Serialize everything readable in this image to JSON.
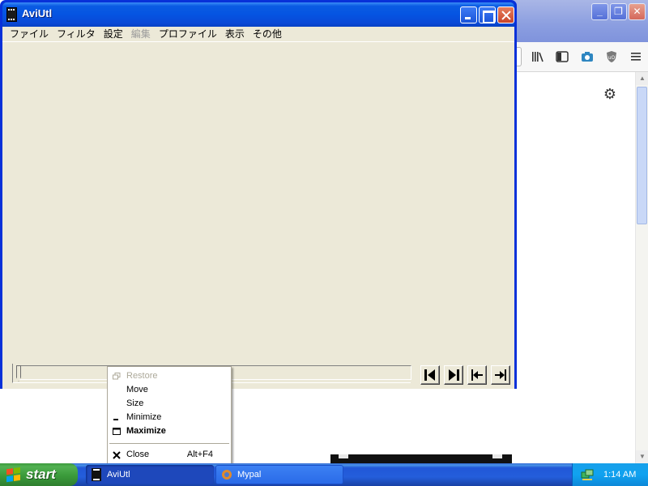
{
  "aviutl": {
    "title": "AviUtl",
    "menu": [
      {
        "label": "ファイル",
        "enabled": true
      },
      {
        "label": "フィルタ",
        "enabled": true
      },
      {
        "label": "設定",
        "enabled": true
      },
      {
        "label": "編集",
        "enabled": false
      },
      {
        "label": "プロファイル",
        "enabled": true
      },
      {
        "label": "表示",
        "enabled": true
      },
      {
        "label": "その他",
        "enabled": true
      }
    ],
    "nav_buttons": [
      "prev-frame-icon",
      "next-frame-icon",
      "first-frame-icon",
      "last-frame-icon"
    ],
    "colors": {
      "titlebar": "#0554e2",
      "client": "#ece9d8"
    }
  },
  "context_menu": {
    "items": [
      {
        "label": "Restore",
        "icon": "restore-icon",
        "enabled": false
      },
      {
        "label": "Move",
        "icon": "",
        "enabled": true
      },
      {
        "label": "Size",
        "icon": "",
        "enabled": true
      },
      {
        "label": "Minimize",
        "icon": "minimize-icon",
        "enabled": true
      },
      {
        "label": "Maximize",
        "icon": "maximize-icon",
        "enabled": true,
        "bold": true
      },
      {
        "label": "Close",
        "icon": "close-icon",
        "enabled": true,
        "shortcut": "Alt+F4"
      }
    ]
  },
  "browser_toolbar": {
    "icons": [
      "library-icon",
      "sidebar-icon",
      "screenshot-icon",
      "ublock-icon",
      "hamburger-menu-icon",
      "settings-gear-icon"
    ]
  },
  "taskbar": {
    "start_label": "start",
    "tasks": [
      {
        "label": "AviUtl",
        "active": true
      },
      {
        "label": "Mypal",
        "active": false
      }
    ],
    "clock": "1:14 AM",
    "colors": {
      "bar": "#245edb",
      "start": "#3a9a3a",
      "tray": "#10a2f0"
    }
  }
}
